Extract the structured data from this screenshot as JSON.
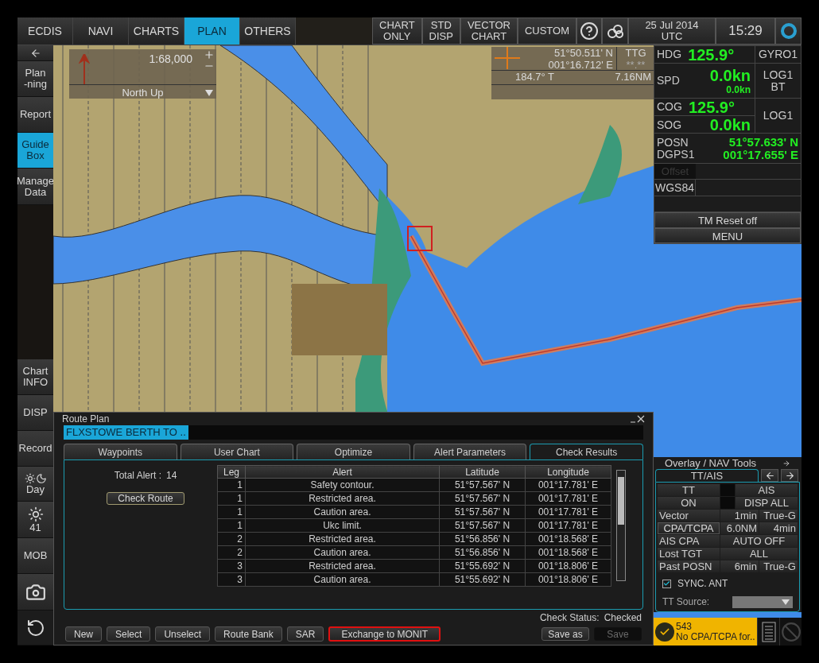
{
  "top_menu": [
    {
      "label": "ECDIS",
      "selected": false
    },
    {
      "label": "NAVI",
      "selected": false
    },
    {
      "label": "CHARTS",
      "selected": false
    },
    {
      "label": "PLAN",
      "selected": true
    },
    {
      "label": "OTHERS",
      "selected": false
    }
  ],
  "display_buttons": [
    {
      "label": "CHART\nONLY"
    },
    {
      "label": "STD\nDISP"
    },
    {
      "label": "VECTOR\nCHART"
    },
    {
      "label": "CUSTOM"
    }
  ],
  "date": "25 Jul 2014",
  "timezone": "UTC",
  "time": "15:29",
  "sidebar_top": [
    {
      "kind": "back",
      "selected": false
    },
    {
      "kind": "text",
      "label": "Plan\n-ning",
      "selected": false
    },
    {
      "kind": "text",
      "label": "Report",
      "selected": false
    },
    {
      "kind": "text",
      "label": "Guide\nBox",
      "selected": true
    },
    {
      "kind": "small",
      "label": "Manage\nData",
      "selected": false
    }
  ],
  "sidebar_bottom": [
    {
      "kind": "text",
      "label": "Chart\nINFO",
      "selected": false
    },
    {
      "kind": "text",
      "label": "DISP",
      "selected": false
    },
    {
      "kind": "text",
      "label": "Record",
      "selected": false
    },
    {
      "kind": "daynight",
      "label": "Day",
      "selected": false
    },
    {
      "kind": "brightness",
      "label": "41",
      "selected": false
    },
    {
      "kind": "text",
      "label": "MOB",
      "selected": false
    },
    {
      "kind": "camera",
      "selected": false
    },
    {
      "kind": "rotate",
      "selected": false
    }
  ],
  "scale_box": {
    "scale": "1:68,000",
    "orientation": "North Up"
  },
  "cursor_box": {
    "lat": "51°50.511' N",
    "lon": "001°16.712' E",
    "ttg_label": "TTG",
    "ttg": "**.**",
    "bearing": "184.7° T",
    "distance": "7.16NM"
  },
  "nav_data": {
    "hdg_label": "HDG",
    "hdg": "125.9°",
    "hdg_source": "GYRO1",
    "spd_label": "SPD",
    "spd": "0.0kn",
    "spd_sub": "0.0kn",
    "spd_source": "LOG1\nBT",
    "cog_label": "COG",
    "cog": "125.9°",
    "sog_label": "SOG",
    "sog": "0.0kn",
    "cog_source": "LOG1",
    "posn_label": "POSN\nDGPS1",
    "posn_lat": "51°57.633' N",
    "posn_lon": "001°17.655' E",
    "offset": "Offset",
    "offset_disabled": true,
    "datum": "WGS84",
    "tm_reset": "TM Reset off",
    "menu": "MENU"
  },
  "route_plan": {
    "title": "Route Plan",
    "route_name": "FLXSTOWE BERTH TO ..",
    "tabs": [
      {
        "label": "Waypoints",
        "selected": false
      },
      {
        "label": "User Chart",
        "selected": false
      },
      {
        "label": "Optimize",
        "selected": false
      },
      {
        "label": "Alert Parameters",
        "selected": false
      },
      {
        "label": "Check Results",
        "selected": true
      }
    ],
    "total_alert_label": "Total Alert :",
    "total_alert": "14",
    "check_route": "Check Route",
    "columns": [
      "Leg",
      "Alert",
      "Latitude",
      "Longitude"
    ],
    "rows": [
      [
        "1",
        "Safety contour.",
        "51°57.567' N",
        "001°17.781' E"
      ],
      [
        "1",
        "Restricted area.",
        "51°57.567' N",
        "001°17.781' E"
      ],
      [
        "1",
        "Caution area.",
        "51°57.567' N",
        "001°17.781' E"
      ],
      [
        "1",
        "Ukc limit.",
        "51°57.567' N",
        "001°17.781' E"
      ],
      [
        "2",
        "Restricted area.",
        "51°56.856' N",
        "001°18.568' E"
      ],
      [
        "2",
        "Caution area.",
        "51°56.856' N",
        "001°18.568' E"
      ],
      [
        "3",
        "Restricted area.",
        "51°55.692' N",
        "001°18.806' E"
      ],
      [
        "3",
        "Caution area.",
        "51°55.692' N",
        "001°18.806' E"
      ]
    ],
    "check_status_label": "Check Status:",
    "check_status": "Checked",
    "buttons": [
      {
        "label": "New",
        "highlighted": false
      },
      {
        "label": "Select",
        "highlighted": false
      },
      {
        "label": "Unselect",
        "highlighted": false
      },
      {
        "label": "Route Bank",
        "highlighted": false
      },
      {
        "label": "SAR",
        "highlighted": false
      },
      {
        "label": "Exchange to MONIT",
        "highlighted": true
      }
    ],
    "right_buttons": [
      {
        "label": "Save as",
        "disabled": false
      },
      {
        "label": "Save",
        "disabled": true
      }
    ]
  },
  "overlay_tools": {
    "title": "Overlay / NAV Tools",
    "tab": "TT/AIS",
    "grid": [
      [
        "TT",
        "AIS"
      ],
      [
        "ON",
        "DISP ALL"
      ]
    ],
    "rows": [
      {
        "label": "Vector",
        "values": [
          "1min",
          "True-G"
        ],
        "label_button": false
      },
      {
        "label": "CPA/TCPA",
        "values": [
          "6.0NM",
          "4min"
        ],
        "label_button": true
      },
      {
        "label": "AIS CPA",
        "values": [
          "AUTO OFF"
        ],
        "label_button": false
      },
      {
        "label": "Lost TGT",
        "values": [
          "ALL"
        ],
        "label_button": false
      },
      {
        "label": "Past POSN",
        "values": [
          "6min",
          "True-G"
        ],
        "label_button": false
      }
    ],
    "sync_ant": {
      "label": "SYNC. ANT",
      "checked": true
    },
    "tt_source_label": "TT Source:"
  },
  "alert": {
    "code": "543",
    "message": "No CPA/TCPA for.."
  }
}
